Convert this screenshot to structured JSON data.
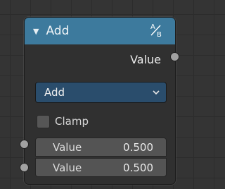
{
  "node": {
    "title": "Add",
    "collapse_icon": "triangle-down-icon",
    "type_icon": "math-operation-icon",
    "header_color": "#3d7a9d",
    "output": {
      "label": "Value"
    },
    "operation": {
      "selected": "Add",
      "icon": "chevron-down-icon"
    },
    "clamp": {
      "label": "Clamp",
      "checked": false
    },
    "inputs": [
      {
        "label": "Value",
        "value": "0.500"
      },
      {
        "label": "Value",
        "value": "0.500"
      }
    ]
  }
}
